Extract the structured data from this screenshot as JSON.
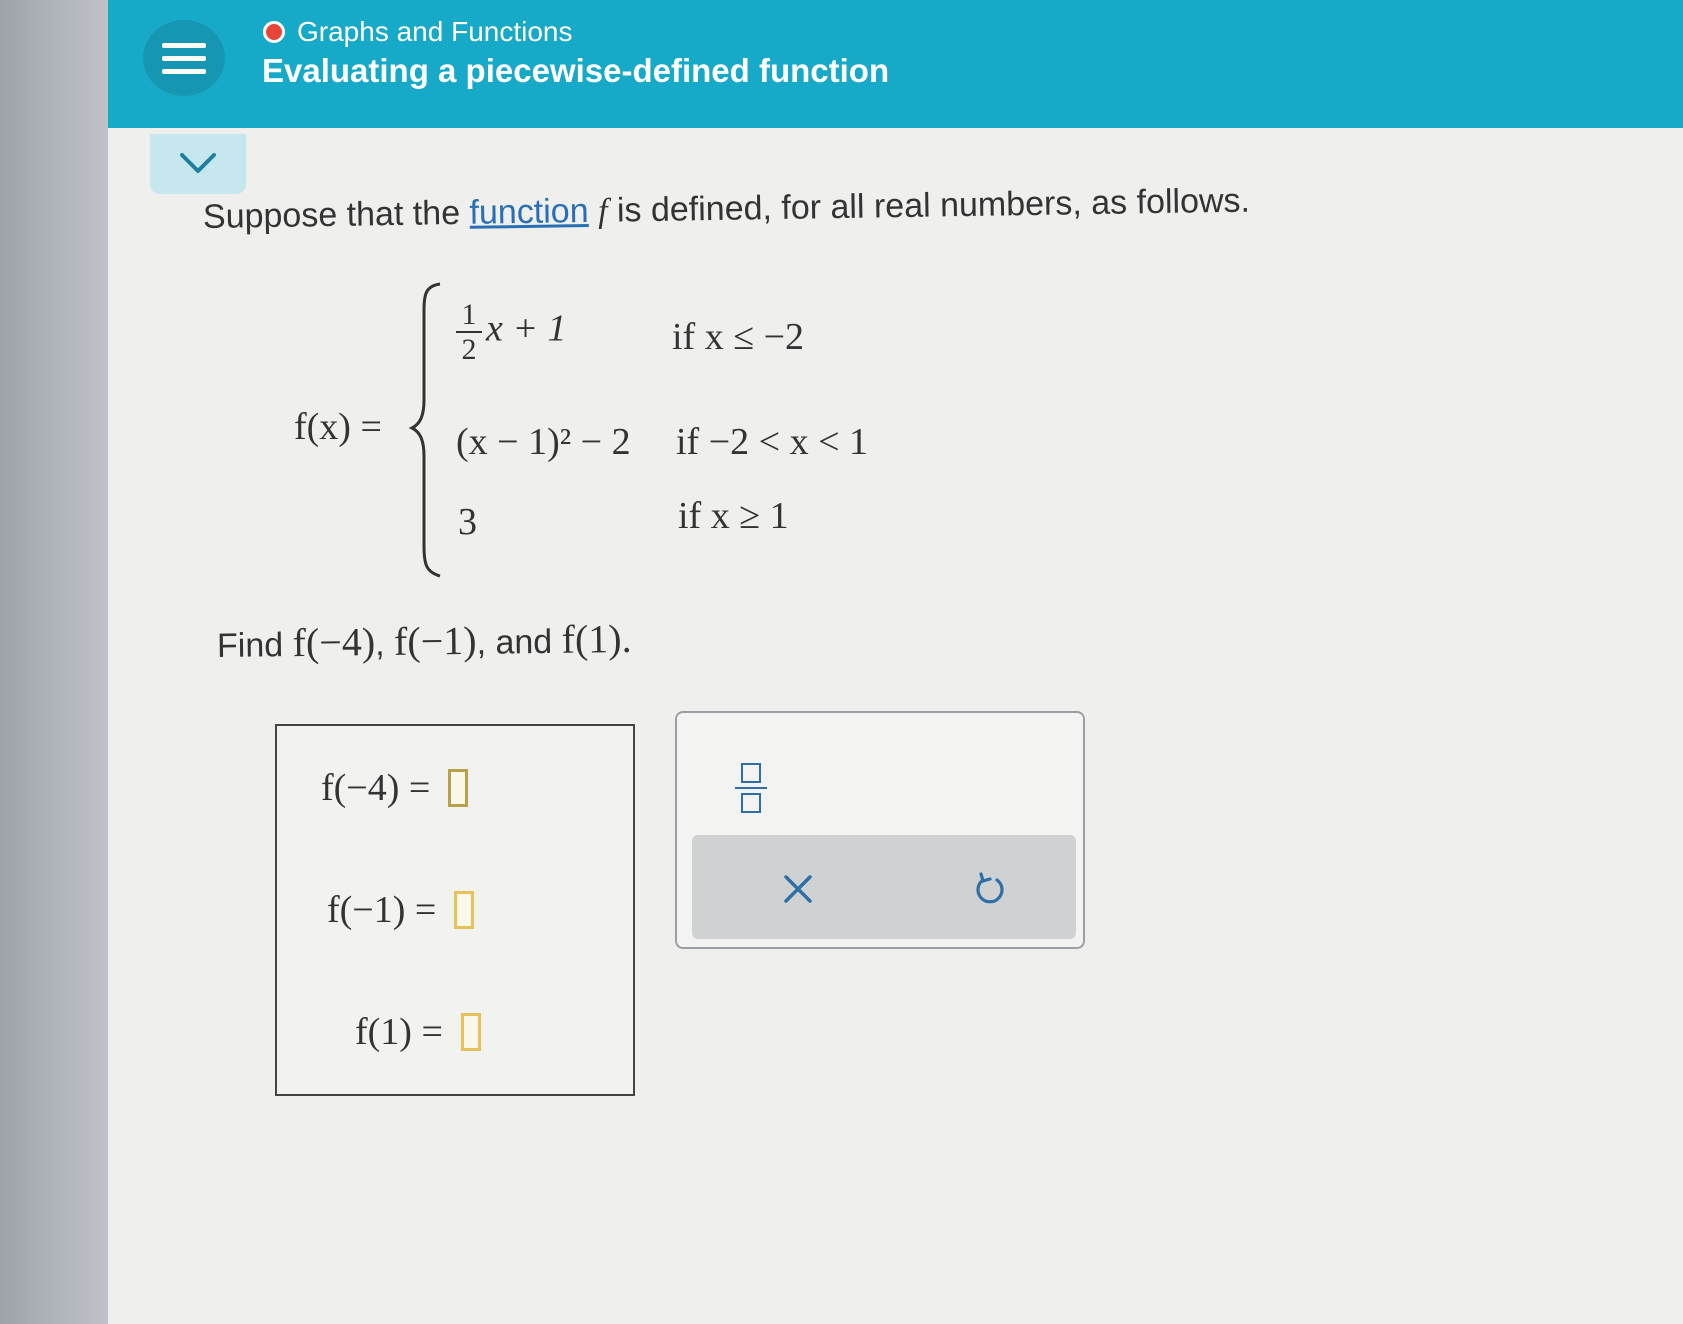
{
  "header": {
    "topic": "Graphs and Functions",
    "title": "Evaluating a piecewise-defined function"
  },
  "problem": {
    "intro_before": "Suppose that the ",
    "intro_link": "function",
    "intro_var": "f",
    "intro_after": "is defined, for all real numbers, as follows.",
    "fx_label": "f(x) =",
    "cases": [
      {
        "expr_frac_num": "1",
        "expr_frac_den": "2",
        "expr_rest": "x + 1",
        "condition": "if x ≤ −2"
      },
      {
        "expr": "(x − 1)² − 2",
        "condition": "if −2 < x < 1"
      },
      {
        "expr": "3",
        "condition": "if x ≥ 1"
      }
    ],
    "find_prefix": "Find ",
    "find_f1": "f(−4)",
    "find_sep1": ", ",
    "find_f2": "f(−1)",
    "find_sep2": ", and ",
    "find_f3": "f(1)",
    "find_end": "."
  },
  "answers": [
    {
      "label": "f(−4) =",
      "value": ""
    },
    {
      "label": "f(−1) =",
      "value": ""
    },
    {
      "label": "f(1) =",
      "value": ""
    }
  ],
  "tools": {
    "fraction_icon": "fraction-icon",
    "clear_icon": "close-icon",
    "undo_icon": "undo-icon"
  },
  "colors": {
    "header_bg": "#17a9c8",
    "topic_dot": "#e8463a",
    "link": "#2a6fb5",
    "input_border": "#e6c25a"
  }
}
